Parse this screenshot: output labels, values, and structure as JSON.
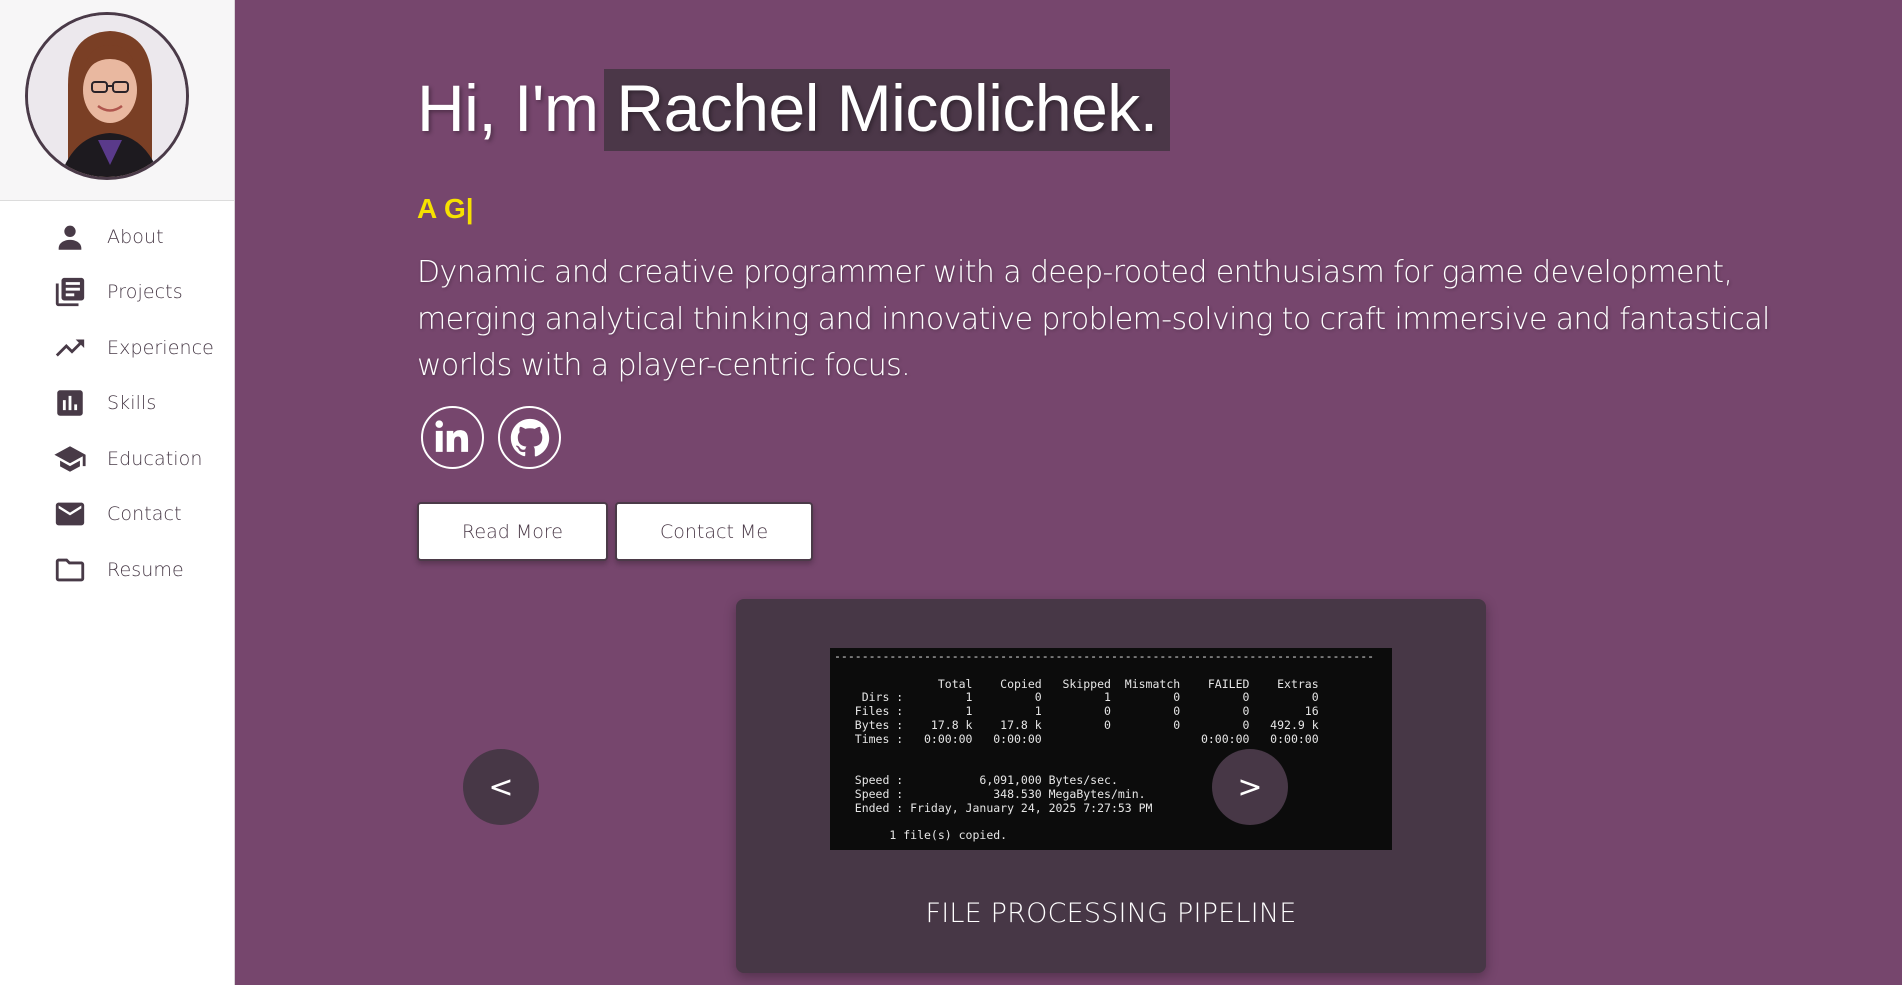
{
  "sidebar": {
    "avatar_alt": "Profile photo",
    "items": [
      {
        "label": "About",
        "icon": "person-icon"
      },
      {
        "label": "Projects",
        "icon": "library-books-icon"
      },
      {
        "label": "Experience",
        "icon": "trending-up-icon"
      },
      {
        "label": "Skills",
        "icon": "bar-chart-icon"
      },
      {
        "label": "Education",
        "icon": "school-icon"
      },
      {
        "label": "Contact",
        "icon": "mail-icon"
      },
      {
        "label": "Resume",
        "icon": "folder-icon"
      }
    ]
  },
  "hero": {
    "greeting": "Hi, I'm",
    "name": "Rachel Micolichek.",
    "tagline": "A G|",
    "bio": "Dynamic and creative programmer with a deep-rooted enthusiasm for game development, merging analytical thinking and innovative problem-solving to craft immersive and fantastical worlds with a player-centric focus."
  },
  "social": {
    "linkedin": "linkedin-icon",
    "github": "github-icon"
  },
  "buttons": {
    "read_more": "Read More",
    "contact_me": "Contact Me"
  },
  "carousel": {
    "prev_label": "<",
    "next_label": ">",
    "caption": "FILE PROCESSING PIPELINE",
    "terminal_lines": [
      "------------------------------------------------------------------------------",
      "",
      "               Total    Copied   Skipped  Mismatch    FAILED    Extras",
      "    Dirs :         1         0         1         0         0         0",
      "   Files :         1         1         0         0         0        16",
      "   Bytes :    17.8 k    17.8 k         0         0         0   492.9 k",
      "   Times :   0:00:00   0:00:00                       0:00:00   0:00:00",
      "",
      "",
      "   Speed :           6,091,000 Bytes/sec.",
      "   Speed :             348.530 MegaBytes/min.",
      "   Ended : Friday, January 24, 2025 7:27:53 PM",
      "",
      "        1 file(s) copied."
    ]
  },
  "colors": {
    "background": "#76466d",
    "accent": "#f6e100",
    "panel": "#473746"
  }
}
